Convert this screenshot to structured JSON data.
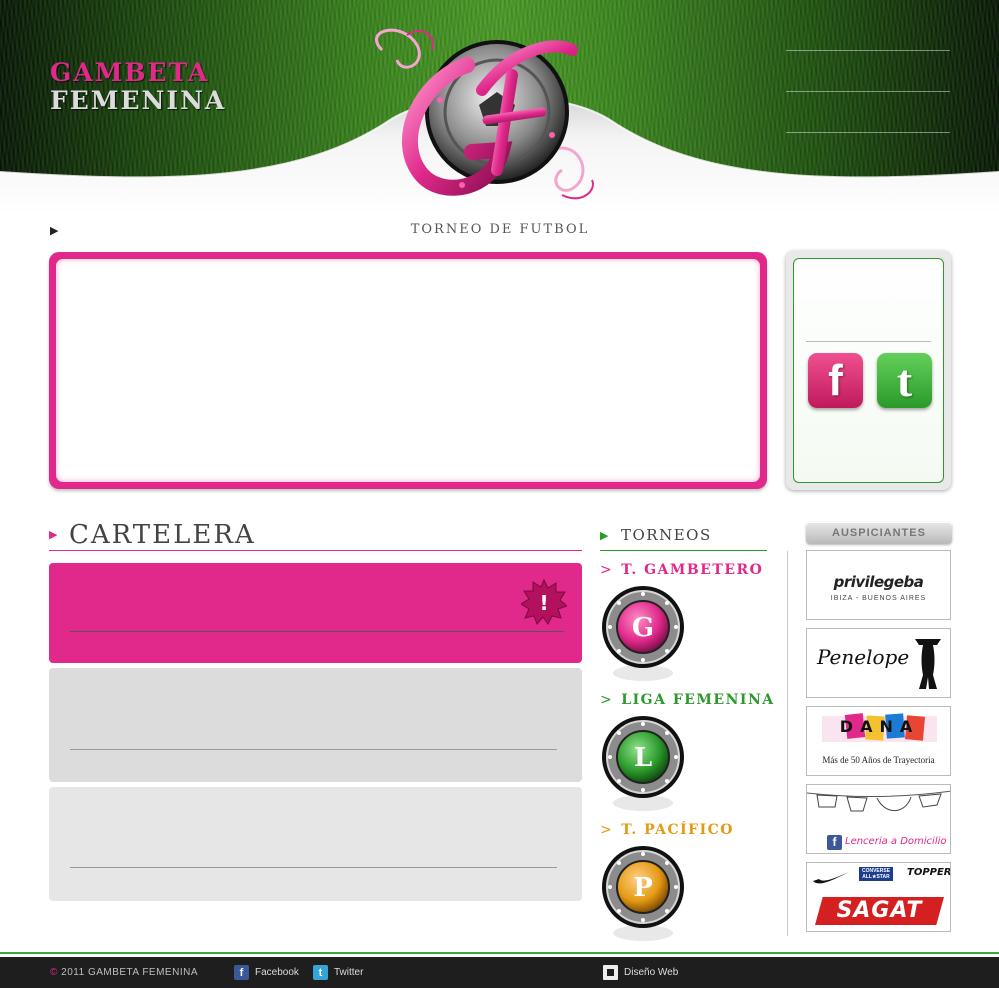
{
  "header": {
    "brand_line1": "GAMBETA",
    "brand_line2": "FEMENINA",
    "tagline": "TORNEO DE FUTBOL",
    "logo_letters": "GF"
  },
  "colors": {
    "accent_pink": "#e0298b",
    "accent_green": "#2b9a2b",
    "accent_orange": "#e59a12"
  },
  "social": {
    "facebook_icon": "facebook-icon",
    "twitter_icon": "twitter-icon",
    "facebook_glyph": "f",
    "twitter_glyph": "t"
  },
  "cartelera": {
    "title": "CARTELERA",
    "alert_glyph": "!"
  },
  "torneos": {
    "title": "TORNEOS",
    "items": [
      {
        "label": "T. GAMBETERO",
        "marker": ">",
        "letter": "G",
        "color": "#e0298b"
      },
      {
        "label": "LIGA FEMENINA",
        "marker": ">",
        "letter": "L",
        "color": "#2b9a2b"
      },
      {
        "label": "T. PACÍFICO",
        "marker": ">",
        "letter": "P",
        "color": "#e59a12"
      }
    ]
  },
  "sponsors": {
    "title": "AUSPICIANTES",
    "items": [
      {
        "name": "privilegeba",
        "sub": "IBIZA - BUENOS AIRES"
      },
      {
        "name": "Penelope"
      },
      {
        "name": "DANA",
        "sub": "Más de 50 Años de Trayectoria"
      },
      {
        "name": "Lenceria a Domicilio"
      },
      {
        "name": "SAGAT",
        "sub1": "CONVERSE ALL★STAR",
        "sub2": "TOPPER"
      }
    ]
  },
  "footer": {
    "copyright_symbol": "©",
    "copyright": "2011 GAMBETA FEMENINA",
    "facebook": "Facebook",
    "twitter": "Twitter",
    "design": "Diseño Web"
  }
}
